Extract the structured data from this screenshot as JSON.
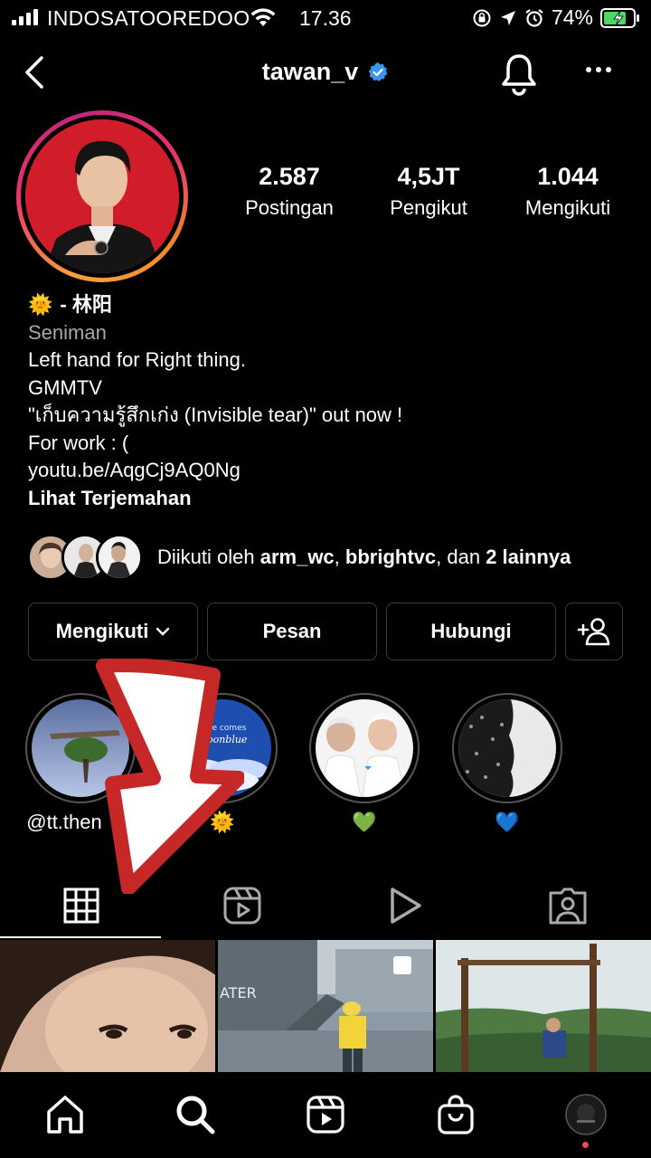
{
  "status_bar": {
    "carrier": "INDOSATOOREDOO",
    "time": "17.36",
    "battery_percent": "74%"
  },
  "header": {
    "username": "tawan_v",
    "verified": true
  },
  "stats": [
    {
      "value": "2.587",
      "label": "Postingan"
    },
    {
      "value": "4,5JT",
      "label": "Pengikut"
    },
    {
      "value": "1.044",
      "label": "Mengikuti"
    }
  ],
  "bio": {
    "emoji": "🌞",
    "name": "- 林阳",
    "category": "Seniman",
    "lines": [
      "Left hand for Right thing.",
      "GMMTV",
      "\"เก็บความรู้สึกเก่ง (Invisible tear)\" out now !",
      "For work : ("
    ],
    "link": "youtu.be/AqgCj9AQ0Ng",
    "translate": "Lihat Terjemahan"
  },
  "followed_by": {
    "prefix": "Diikuti oleh ",
    "user1": "arm_wc",
    "sep1": ", ",
    "user2": "bbrightvc",
    "sep2": ", dan ",
    "others": "2 lainnya"
  },
  "buttons": {
    "following": "Mengikuti",
    "message": "Pesan",
    "contact": "Hubungi"
  },
  "highlights": [
    {
      "label": "@tt.then"
    },
    {
      "label": "🌞"
    },
    {
      "label": "💚"
    },
    {
      "label": "💙"
    }
  ],
  "highlight2_text": "here comes\nmoonblue",
  "colors": {
    "verified_badge": "#3897f0",
    "story_ring_start": "#f9a03c",
    "story_ring_end": "#c1267a",
    "annotation_arrow": "#c62828"
  }
}
